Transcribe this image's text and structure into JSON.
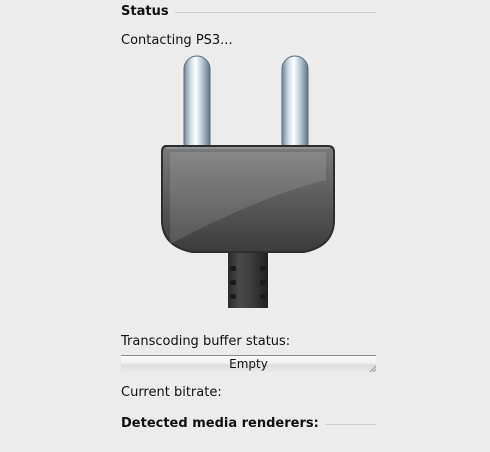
{
  "status_section": {
    "title": "Status",
    "message": "Contacting PS3..."
  },
  "plug_icon": {
    "name": "power-plug-icon"
  },
  "transcoding": {
    "label": "Transcoding buffer status:",
    "buffer_value": "Empty",
    "buffer_fill_fraction": 0
  },
  "bitrate": {
    "label": "Current bitrate:"
  },
  "renderers_section": {
    "title": "Detected media renderers:"
  }
}
